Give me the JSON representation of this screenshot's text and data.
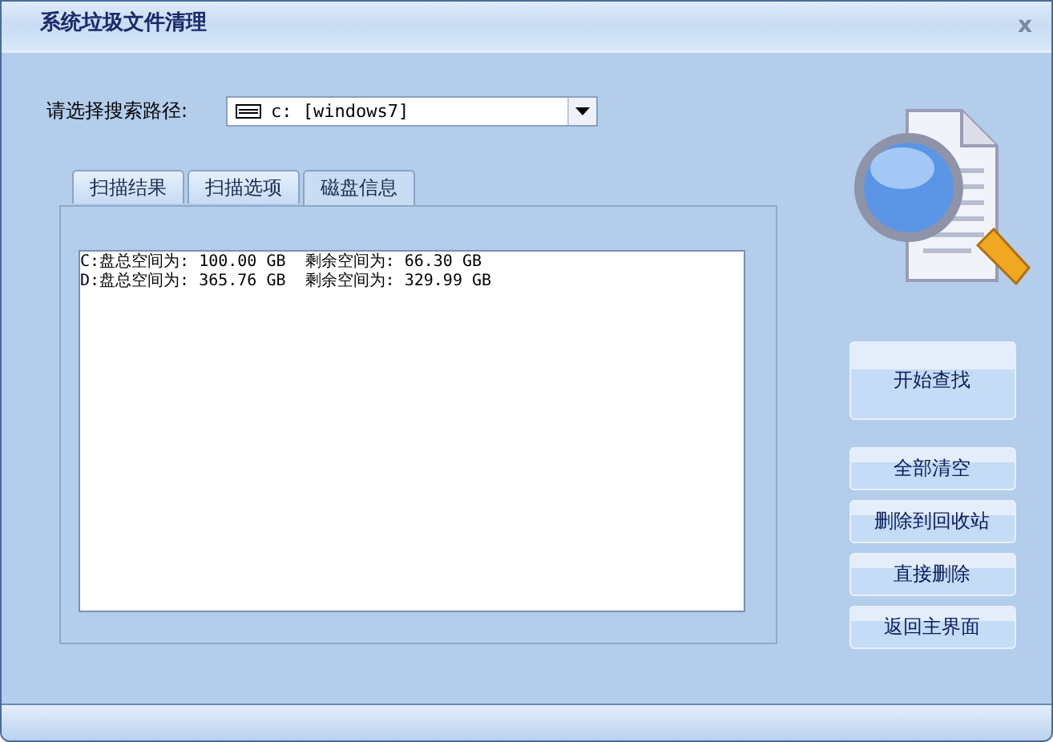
{
  "window": {
    "title": "系统垃圾文件清理",
    "close": "x"
  },
  "path": {
    "label": "请选择搜索路径:",
    "value": "c: [windows7]"
  },
  "tabs": [
    {
      "label": "扫描结果",
      "selected": false
    },
    {
      "label": "扫描选项",
      "selected": false
    },
    {
      "label": "磁盘信息",
      "selected": true
    }
  ],
  "disk_info": [
    "C:盘总空间为: 100.00 GB  剩余空间为: 66.30 GB",
    "D:盘总空间为: 365.76 GB  剩余空间为: 329.99 GB"
  ],
  "buttons": [
    {
      "label": "开始查找",
      "kind": "large"
    },
    {
      "label": "全部清空",
      "kind": "small"
    },
    {
      "label": "删除到回收站",
      "kind": "small"
    },
    {
      "label": "直接删除",
      "kind": "small"
    },
    {
      "label": "返回主界面",
      "kind": "small"
    }
  ]
}
